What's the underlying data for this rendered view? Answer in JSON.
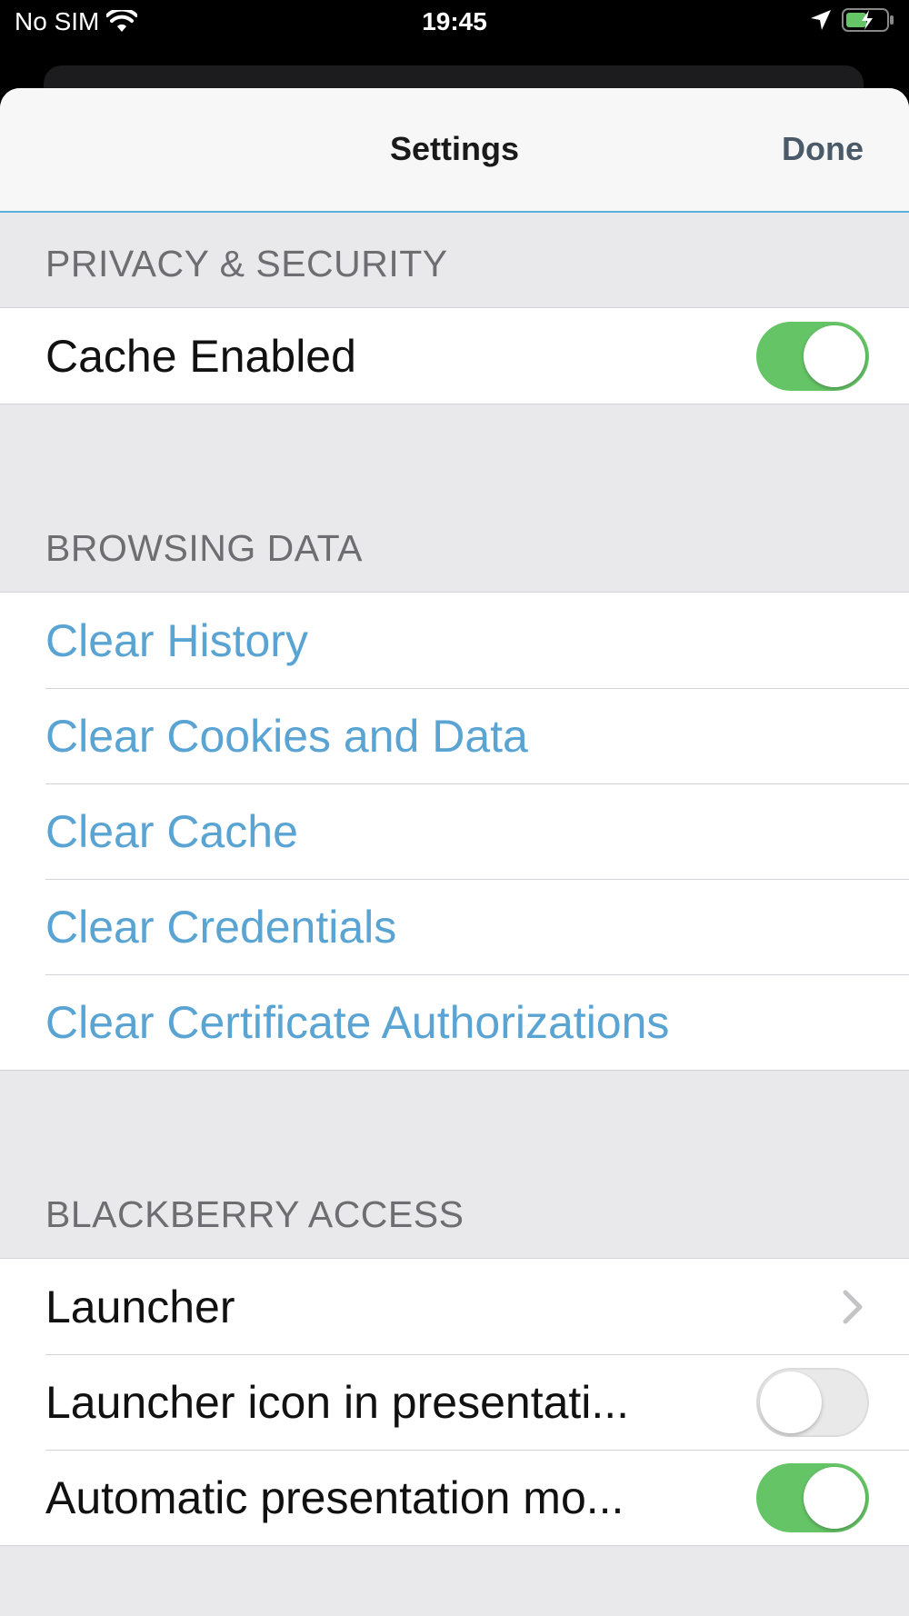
{
  "status_bar": {
    "carrier": "No SIM",
    "time": "19:45",
    "icons": [
      "wifi-icon",
      "location-arrow-icon",
      "battery-charging-icon"
    ]
  },
  "nav": {
    "title": "Settings",
    "done_label": "Done",
    "divider_color": "#5ab0dc"
  },
  "sections": {
    "privacy": {
      "header": "PRIVACY & SECURITY",
      "cache_enabled": {
        "label": "Cache Enabled",
        "on": true
      }
    },
    "browsing": {
      "header": "BROWSING DATA",
      "actions": [
        "Clear History",
        "Clear Cookies and Data",
        "Clear Cache",
        "Clear Credentials",
        "Clear Certificate Authorizations"
      ]
    },
    "access": {
      "header": "BLACKBERRY ACCESS",
      "launcher": {
        "label": "Launcher",
        "icon": "chevron-right-icon"
      },
      "launcher_icon_presentation": {
        "label": "Launcher icon in presentati...",
        "on": false
      },
      "auto_presentation": {
        "label": "Automatic presentation mo...",
        "on": true
      }
    }
  },
  "colors": {
    "toggle_on": "#65c466",
    "action_text": "#5aa4d4",
    "section_header": "#6d6d72"
  }
}
